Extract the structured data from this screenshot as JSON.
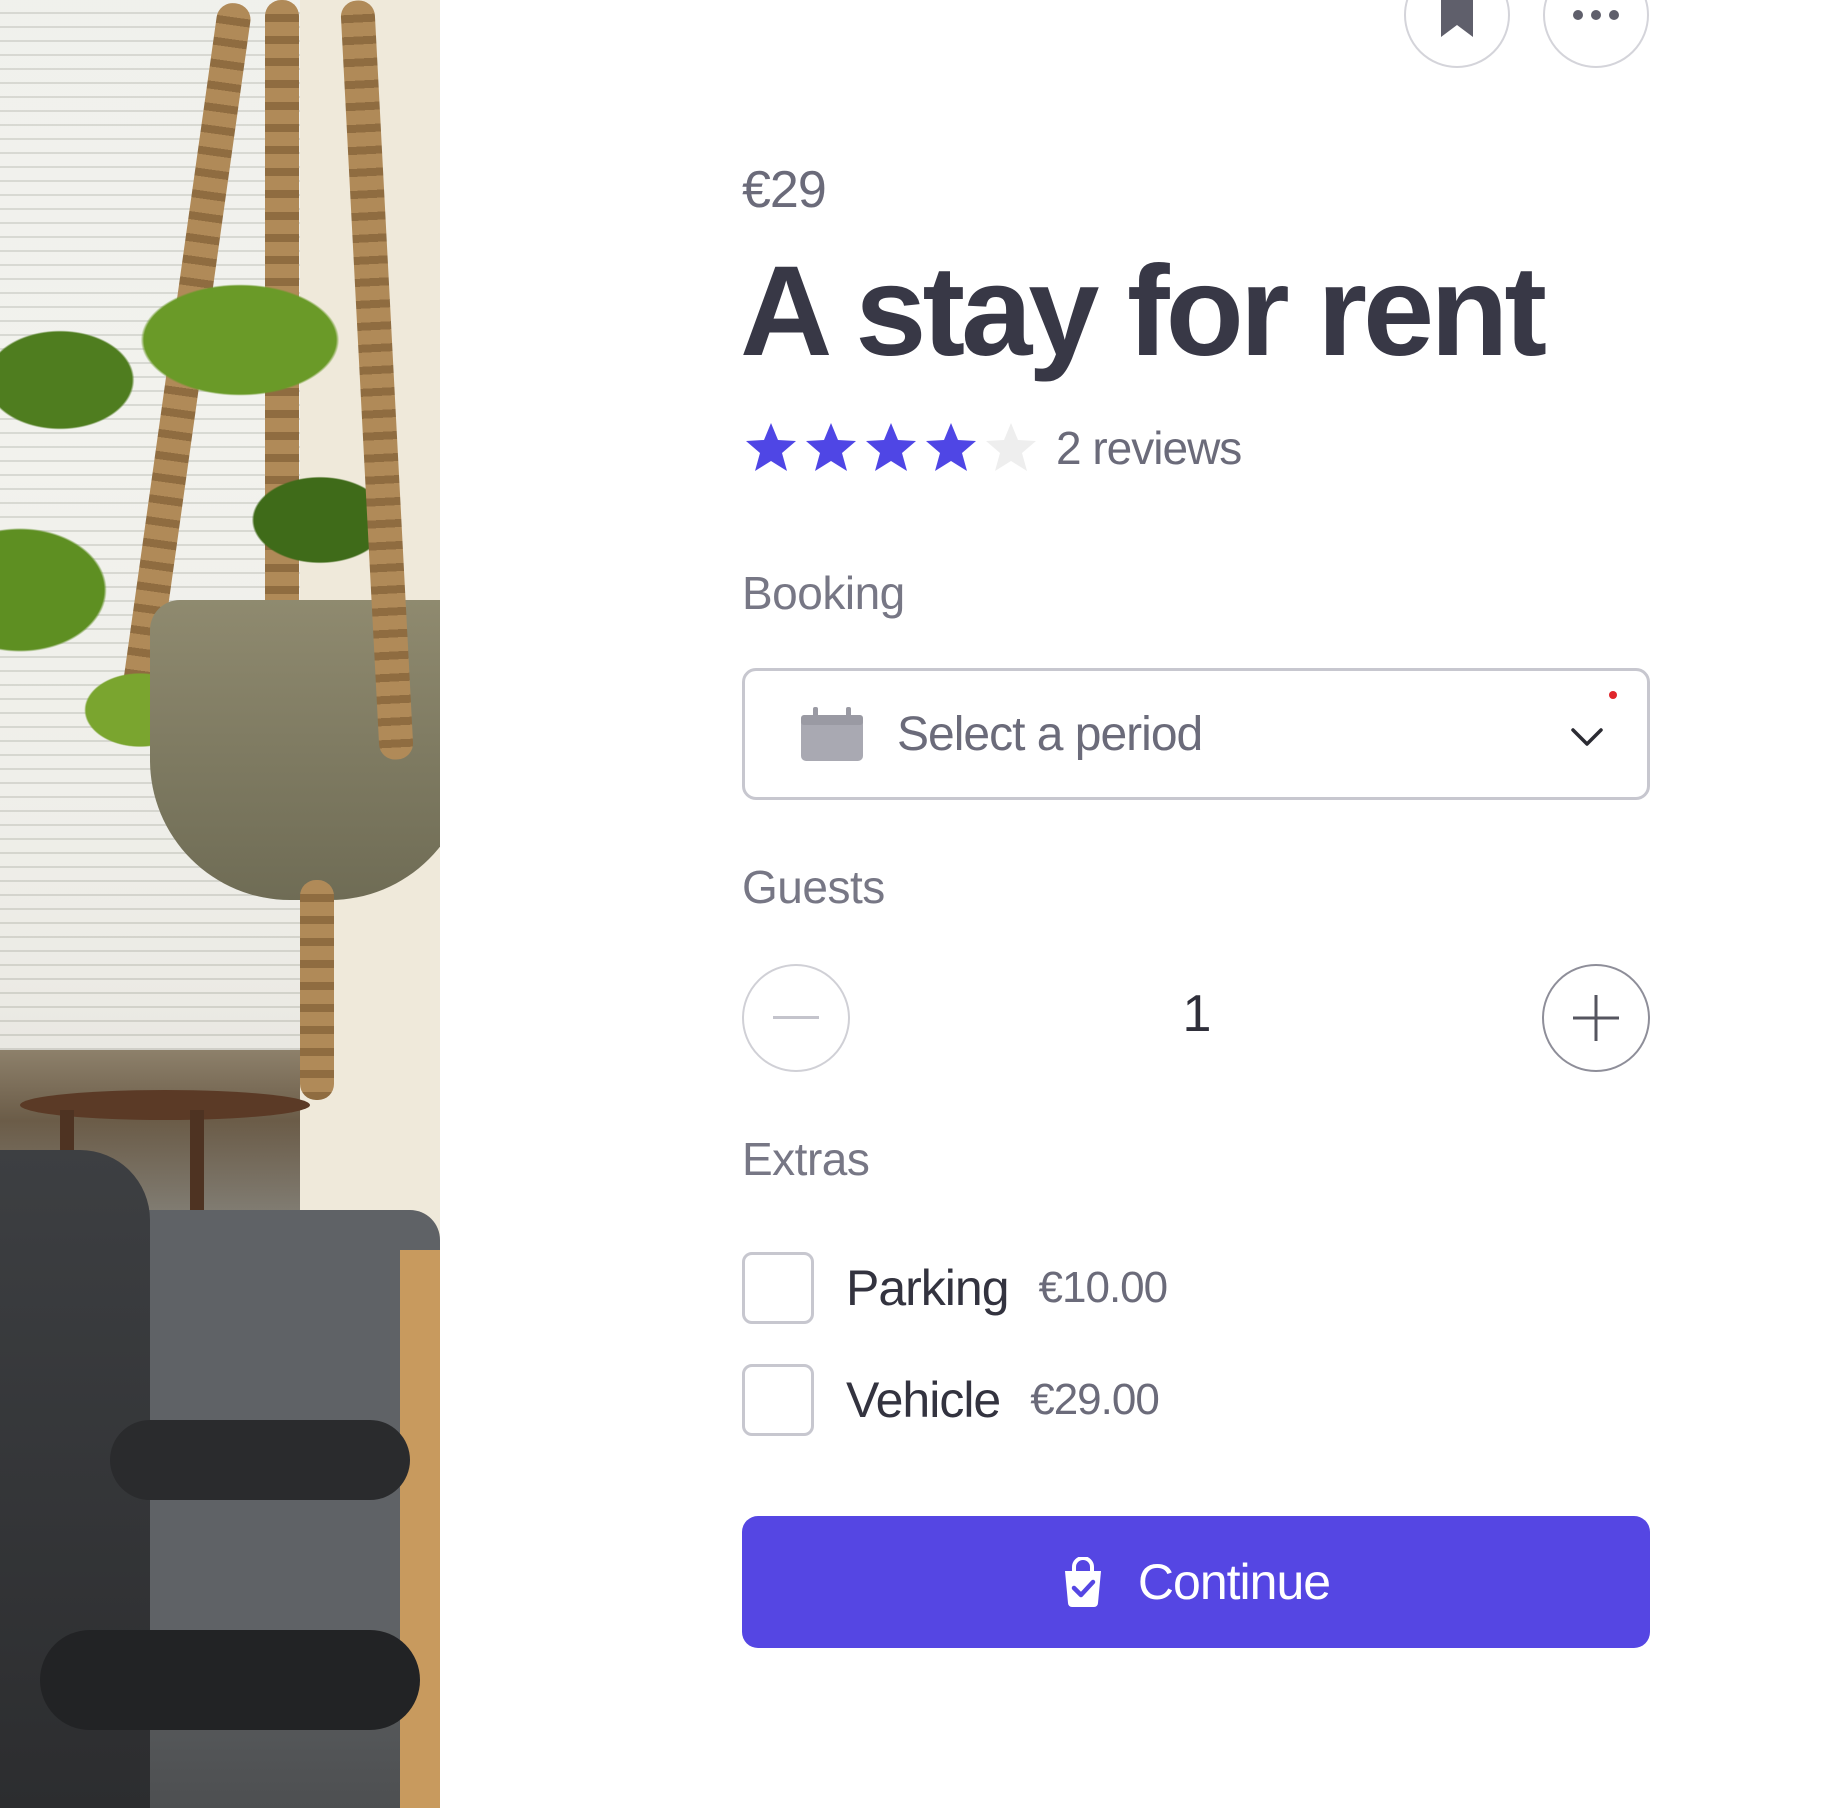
{
  "listing": {
    "price": "€29",
    "title": "A stay for rent",
    "rating": 4,
    "rating_max": 5,
    "reviews_label": "2 reviews"
  },
  "actions": {
    "bookmark_icon": "bookmark-icon",
    "more_icon": "more-horizontal-icon"
  },
  "booking": {
    "label": "Booking",
    "placeholder": "Select a period",
    "icon": "calendar-icon"
  },
  "guests": {
    "label": "Guests",
    "count": "1"
  },
  "extras": {
    "label": "Extras",
    "items": [
      {
        "name": "Parking",
        "price": "€10.00",
        "checked": false
      },
      {
        "name": "Vehicle",
        "price": "€29.00",
        "checked": false
      }
    ]
  },
  "continue": {
    "label": "Continue",
    "icon": "shopping-bag-check-icon"
  },
  "colors": {
    "accent": "#5546e3",
    "star_filled": "#4f46e5",
    "star_empty": "#eeeeee",
    "text_primary": "#383846",
    "text_muted": "#6b6b7a"
  }
}
